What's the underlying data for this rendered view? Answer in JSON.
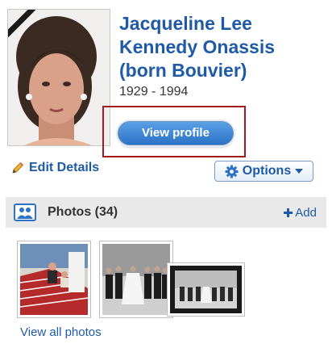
{
  "profile": {
    "name_lines": [
      "Jacqueline Lee",
      "Kennedy Onassis",
      "(born Bouvier)"
    ],
    "dates": "1929 - 1994",
    "view_profile_label": "View profile"
  },
  "actions": {
    "edit_details_label": "Edit Details",
    "options_label": "Options"
  },
  "photos": {
    "title": "Photos (34)",
    "add_label": "Add",
    "view_all_label": "View all photos"
  },
  "colors": {
    "link": "#1f5aa6",
    "highlight": "#9f1d1d",
    "header_bg": "#e9e9e9"
  },
  "icons": {
    "edit": "pencil-icon",
    "options": "gear-icon",
    "options_caret": "caret-down-icon",
    "photos": "photo-people-icon",
    "add": "plus-icon"
  }
}
